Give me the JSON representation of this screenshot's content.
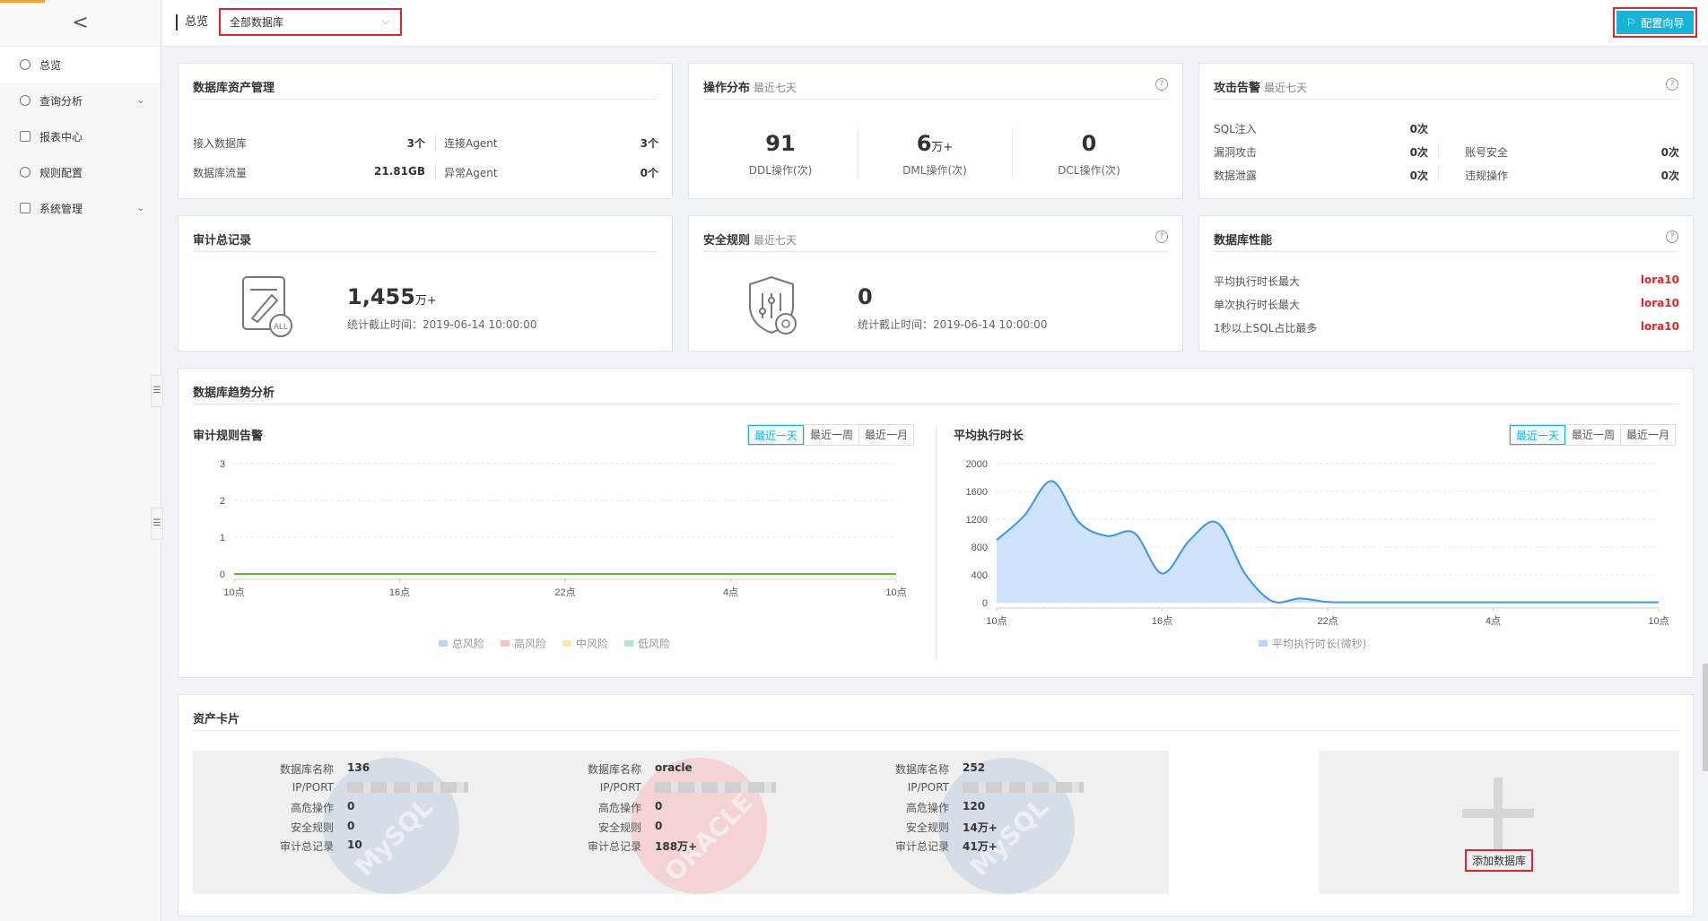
{
  "sidebar": {
    "back_glyph": "<",
    "items": [
      {
        "label": "总览",
        "icon": "dashboard-icon"
      },
      {
        "label": "查询分析",
        "icon": "search-icon",
        "arrow": "⌄"
      },
      {
        "label": "报表中心",
        "icon": "report-icon"
      },
      {
        "label": "规则配置",
        "icon": "rule-icon"
      },
      {
        "label": "系统管理",
        "icon": "system-icon",
        "arrow": "⌄"
      }
    ]
  },
  "header": {
    "breadcrumb": "总览",
    "db_select": "全部数据库",
    "guide_label": "配置向导"
  },
  "asset_mgmt": {
    "title": "数据库资产管理",
    "rows": [
      {
        "label": "接入数据库",
        "value": "3个"
      },
      {
        "label": "连接Agent",
        "value": "3个"
      },
      {
        "label": "数据库流量",
        "value": "21.81GB"
      },
      {
        "label": "异常Agent",
        "value": "0个"
      }
    ]
  },
  "op_dist": {
    "title": "操作分布",
    "sub": "最近七天",
    "items": [
      {
        "value": "91",
        "unit": "",
        "label": "DDL操作(次)"
      },
      {
        "value": "6",
        "unit": "万+",
        "label": "DML操作(次)"
      },
      {
        "value": "0",
        "unit": "",
        "label": "DCL操作(次)"
      }
    ]
  },
  "attack": {
    "title": "攻击告警",
    "sub": "最近七天",
    "rows": [
      {
        "label": "SQL注入",
        "value": "0次"
      },
      {
        "label": "漏洞攻击",
        "value": "0次"
      },
      {
        "label": "账号安全",
        "value": "0次"
      },
      {
        "label": "数据泄露",
        "value": "0次"
      },
      {
        "label": "违规操作",
        "value": "0次"
      }
    ]
  },
  "audit_total": {
    "title": "审计总记录",
    "value": "1,455",
    "unit": "万+",
    "note": "统计截止时间：2019-06-14 10:00:00",
    "icon_text": "ALL"
  },
  "sec_rules": {
    "title": "安全规则",
    "sub": "最近七天",
    "value": "0",
    "note": "统计截止时间：2019-06-14 10:00:00"
  },
  "db_perf": {
    "title": "数据库性能",
    "rows": [
      {
        "label": "平均执行时长最大",
        "value": "lora10"
      },
      {
        "label": "单次执行时长最大",
        "value": "lora10"
      },
      {
        "label": "1秒以上SQL占比最多",
        "value": "lora10"
      }
    ]
  },
  "trend": {
    "title": "数据库趋势分析",
    "ranges": [
      "最近一天",
      "最近一周",
      "最近一月"
    ]
  },
  "chart_data": [
    {
      "type": "line",
      "title": "审计规则告警",
      "categories": [
        "10点",
        "16点",
        "22点",
        "4点",
        "10点"
      ],
      "x": [
        0,
        6,
        12,
        18,
        24
      ],
      "ylim": [
        0,
        3
      ],
      "yticks": [
        "0",
        "1",
        "2",
        "3"
      ],
      "series": [
        {
          "name": "总风险",
          "color": "#b9d6f3",
          "values": [
            0,
            0,
            0,
            0,
            0
          ]
        },
        {
          "name": "高风险",
          "color": "#f4c4c4",
          "values": [
            0,
            0,
            0,
            0,
            0
          ]
        },
        {
          "name": "中风险",
          "color": "#fbe7b0",
          "values": [
            0,
            0,
            0,
            0,
            0
          ]
        },
        {
          "name": "低风险",
          "color": "#52c41a",
          "values": [
            0,
            0,
            0,
            0,
            0
          ]
        }
      ],
      "grid": true,
      "legend": "bottom"
    },
    {
      "type": "area",
      "title": "平均执行时长",
      "categories": [
        "10点",
        "16点",
        "22点",
        "4点",
        "10点"
      ],
      "ylim": [
        0,
        2000
      ],
      "yticks": [
        "0",
        "400",
        "800",
        "1200",
        "1600",
        "2000"
      ],
      "x": [
        0,
        1,
        2,
        3,
        4,
        5,
        6,
        7,
        8,
        9,
        10,
        11,
        12,
        13,
        14,
        15,
        16,
        17,
        18,
        19,
        20,
        21,
        22,
        23,
        24
      ],
      "series": [
        {
          "name": "平均执行时长(微秒)",
          "color": "#3a93f0",
          "fill": "#cfe4fb",
          "values": [
            900,
            1250,
            1750,
            1150,
            960,
            1000,
            420,
            900,
            1150,
            420,
            20,
            60,
            10,
            5,
            5,
            5,
            5,
            5,
            5,
            5,
            5,
            5,
            5,
            5,
            5
          ]
        }
      ],
      "grid": true,
      "legend": "bottom"
    }
  ],
  "assets": {
    "title": "资产卡片",
    "labels": [
      "数据库名称",
      "IP/PORT",
      "高危操作",
      "安全规则",
      "审计总记录"
    ],
    "cards": [
      {
        "name": "136",
        "high": "0",
        "rules": "0",
        "audit": "10",
        "color": "#d5dde6",
        "wm": "MySQL"
      },
      {
        "name": "oracle",
        "high": "0",
        "rules": "0",
        "audit": "188万+",
        "color": "#f3d3d3",
        "wm": "ORACLE"
      },
      {
        "name": "252",
        "high": "120",
        "rules": "14万+",
        "audit": "41万+",
        "color": "#d5dde6",
        "wm": "MySQL"
      }
    ],
    "add_label": "添加数据库",
    "plus": "+"
  }
}
